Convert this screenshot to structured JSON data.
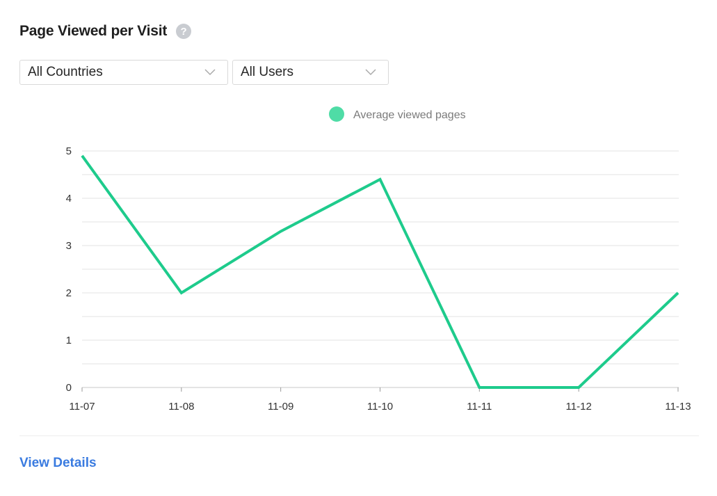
{
  "header": {
    "title": "Page Viewed per Visit",
    "help_icon": "question-circle-icon",
    "help_glyph": "?"
  },
  "filters": {
    "country": {
      "value": "All Countries",
      "icon": "chevron-down-icon"
    },
    "users": {
      "value": "All Users",
      "icon": "chevron-down-icon"
    }
  },
  "footer": {
    "link_label": "View Details"
  },
  "colors": {
    "line": "#1ecb8c",
    "legend_dot": "#4fdca6",
    "grid": "#e3e3e3",
    "link": "#3a7be0"
  },
  "chart_data": {
    "type": "line",
    "title": "",
    "xlabel": "",
    "ylabel": "",
    "categories": [
      "11-07",
      "11-08",
      "11-09",
      "11-10",
      "11-11",
      "11-12",
      "11-13"
    ],
    "series": [
      {
        "name": "Average viewed pages",
        "values": [
          4.9,
          2.0,
          3.3,
          4.4,
          0,
          0,
          2.0
        ]
      }
    ],
    "ylim": [
      0,
      5
    ],
    "yticks": [
      0,
      1,
      2,
      3,
      4,
      5
    ],
    "grid": true,
    "legend_position": "top-center"
  }
}
